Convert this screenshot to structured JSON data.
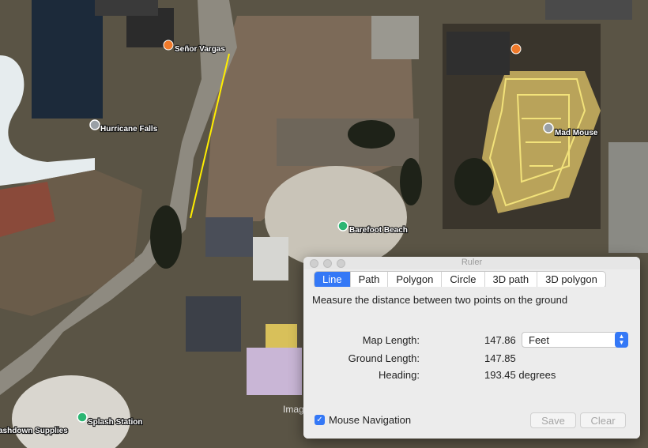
{
  "map": {
    "poi": [
      {
        "name": "Señor Vargas",
        "icon": "restaurant-marker-icon",
        "color": "#f07a2a"
      },
      {
        "name": "Hurricane Falls",
        "icon": "attraction-marker-icon",
        "color": "#9aa0a6"
      },
      {
        "name": "Mad Mouse",
        "icon": "attraction-marker-icon",
        "color": "#9aa0a6"
      },
      {
        "name": "Barefoot Beach",
        "icon": "park-marker-icon",
        "color": "#2bb673"
      },
      {
        "name": "Splash Station",
        "icon": "park-marker-icon",
        "color": "#2bb673"
      },
      {
        "name": "ashdown Supplies",
        "icon": "none",
        "color": "#ffffff"
      }
    ],
    "extra_marker_icon": "restaurant-marker-icon",
    "partial_watermark": "Imag",
    "measure_line_color": "#ffee00"
  },
  "ruler": {
    "title": "Ruler",
    "tabs": [
      "Line",
      "Path",
      "Polygon",
      "Circle",
      "3D path",
      "3D polygon"
    ],
    "active_tab": "Line",
    "description": "Measure the distance between two points on the ground",
    "map_length": {
      "label": "Map Length:",
      "value": "147.86"
    },
    "unit": "Feet",
    "ground_length": {
      "label": "Ground Length:",
      "value": "147.85"
    },
    "heading": {
      "label": "Heading:",
      "value": "193.45 degrees"
    },
    "mouse_navigation": {
      "label": "Mouse Navigation",
      "checked": true
    },
    "save_label": "Save",
    "clear_label": "Clear",
    "accent_color": "#3478f6"
  }
}
